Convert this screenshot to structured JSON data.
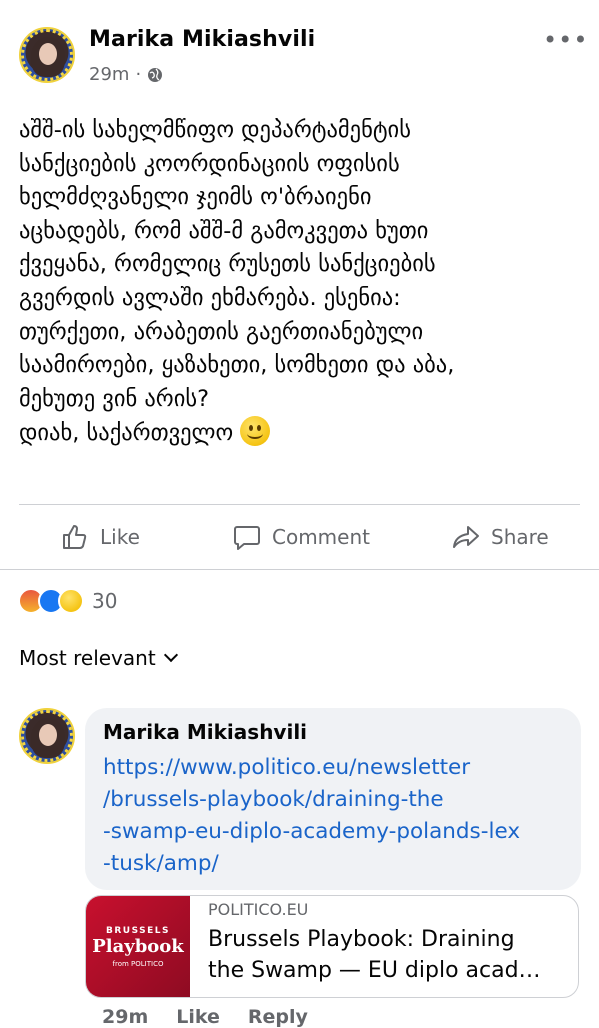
{
  "post": {
    "author": "Marika Mikiashvili",
    "time": "29m",
    "separator": "·",
    "body": "აშშ-ის სახელმწიფო დეპარტამენტის\nსანქციების კოორდინაციის ოფისის\nხელმძღვანელი ჯეიმს ო'ბრაიენი\nაცხადებს, რომ აშშ-მ გამოკვეთა ხუთი\nქვეყანა, რომელიც რუსეთს სანქციების\nგვერდის ავლაში ეხმარება. ესენია:\nთურქეთი, არაბეთის გაერთიანებული\nსაამიროები, ყაზახეთი, სომხეთი და აბა,\nმეხუთე ვინ არის?\nდიახ, საქართველო "
  },
  "actions": {
    "like": "Like",
    "comment": "Comment",
    "share": "Share"
  },
  "reactions": {
    "count": "30",
    "types": [
      "angry",
      "like",
      "sad"
    ]
  },
  "sort": {
    "label": "Most relevant"
  },
  "comment": {
    "author": "Marika Mikiashvili",
    "text": "https://www.politico.eu/newsletter\n/brussels-playbook/draining-the\n-swamp-eu-diplo-academy-polands-lex\n-tusk/amp/",
    "link_card": {
      "thumb_small": "BRUSSELS",
      "thumb_big": "Playbook",
      "thumb_from": "from POLITICO",
      "domain": "POLITICO.EU",
      "title": "Brussels Playbook: Draining\nthe Swamp — EU diplo acad…"
    },
    "footer": {
      "time": "29m",
      "like": "Like",
      "reply": "Reply"
    }
  },
  "colors": {
    "link": "#1a64c9",
    "muted": "#65676b",
    "bubble": "#f0f2f5",
    "politico_red": "#c8102e"
  },
  "icons": [
    "globe-icon",
    "more-icon",
    "like-icon",
    "comment-icon",
    "share-icon",
    "chevron-down-icon",
    "smile-emoji-icon"
  ]
}
